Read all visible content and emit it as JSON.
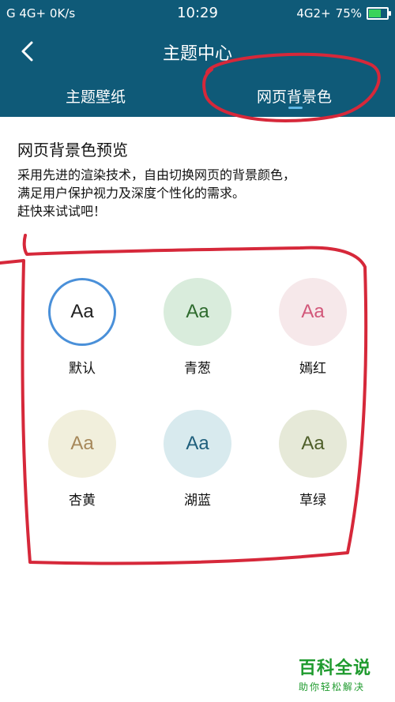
{
  "status_bar": {
    "left": "G  4G+  0K/s",
    "time": "10:29",
    "network": "4G2+",
    "battery": "75%",
    "battery_level": 0.75
  },
  "header": {
    "title": "主题中心"
  },
  "tabs": [
    {
      "label": "主题壁纸"
    },
    {
      "label": "网页背景色"
    }
  ],
  "preview": {
    "heading": "网页背景色预览",
    "line1": "采用先进的渲染技术，自由切换网页的背景颜色，",
    "line2": "满足用户保护视力及深度个性化的需求。",
    "line3": "赶快来试试吧！"
  },
  "colors": [
    {
      "sample": "Aa",
      "name": "默认",
      "bg": "#ffffff",
      "fg": "#222222",
      "border": "#4a90d9"
    },
    {
      "sample": "Aa",
      "name": "青葱",
      "bg": "#d9ecdc",
      "fg": "#2e6b2e"
    },
    {
      "sample": "Aa",
      "name": "嫣红",
      "bg": "#f6e8ea",
      "fg": "#d2587a"
    },
    {
      "sample": "Aa",
      "name": "杏黄",
      "bg": "#f1efdc",
      "fg": "#a6885a"
    },
    {
      "sample": "Aa",
      "name": "湖蓝",
      "bg": "#d8eaee",
      "fg": "#1f5f7c"
    },
    {
      "sample": "Aa",
      "name": "草绿",
      "bg": "#e6e9d8",
      "fg": "#4f5f2a"
    }
  ],
  "watermark": {
    "line1": "百科全说",
    "line2": "助你轻松解决"
  },
  "accent": "#0f5a78"
}
